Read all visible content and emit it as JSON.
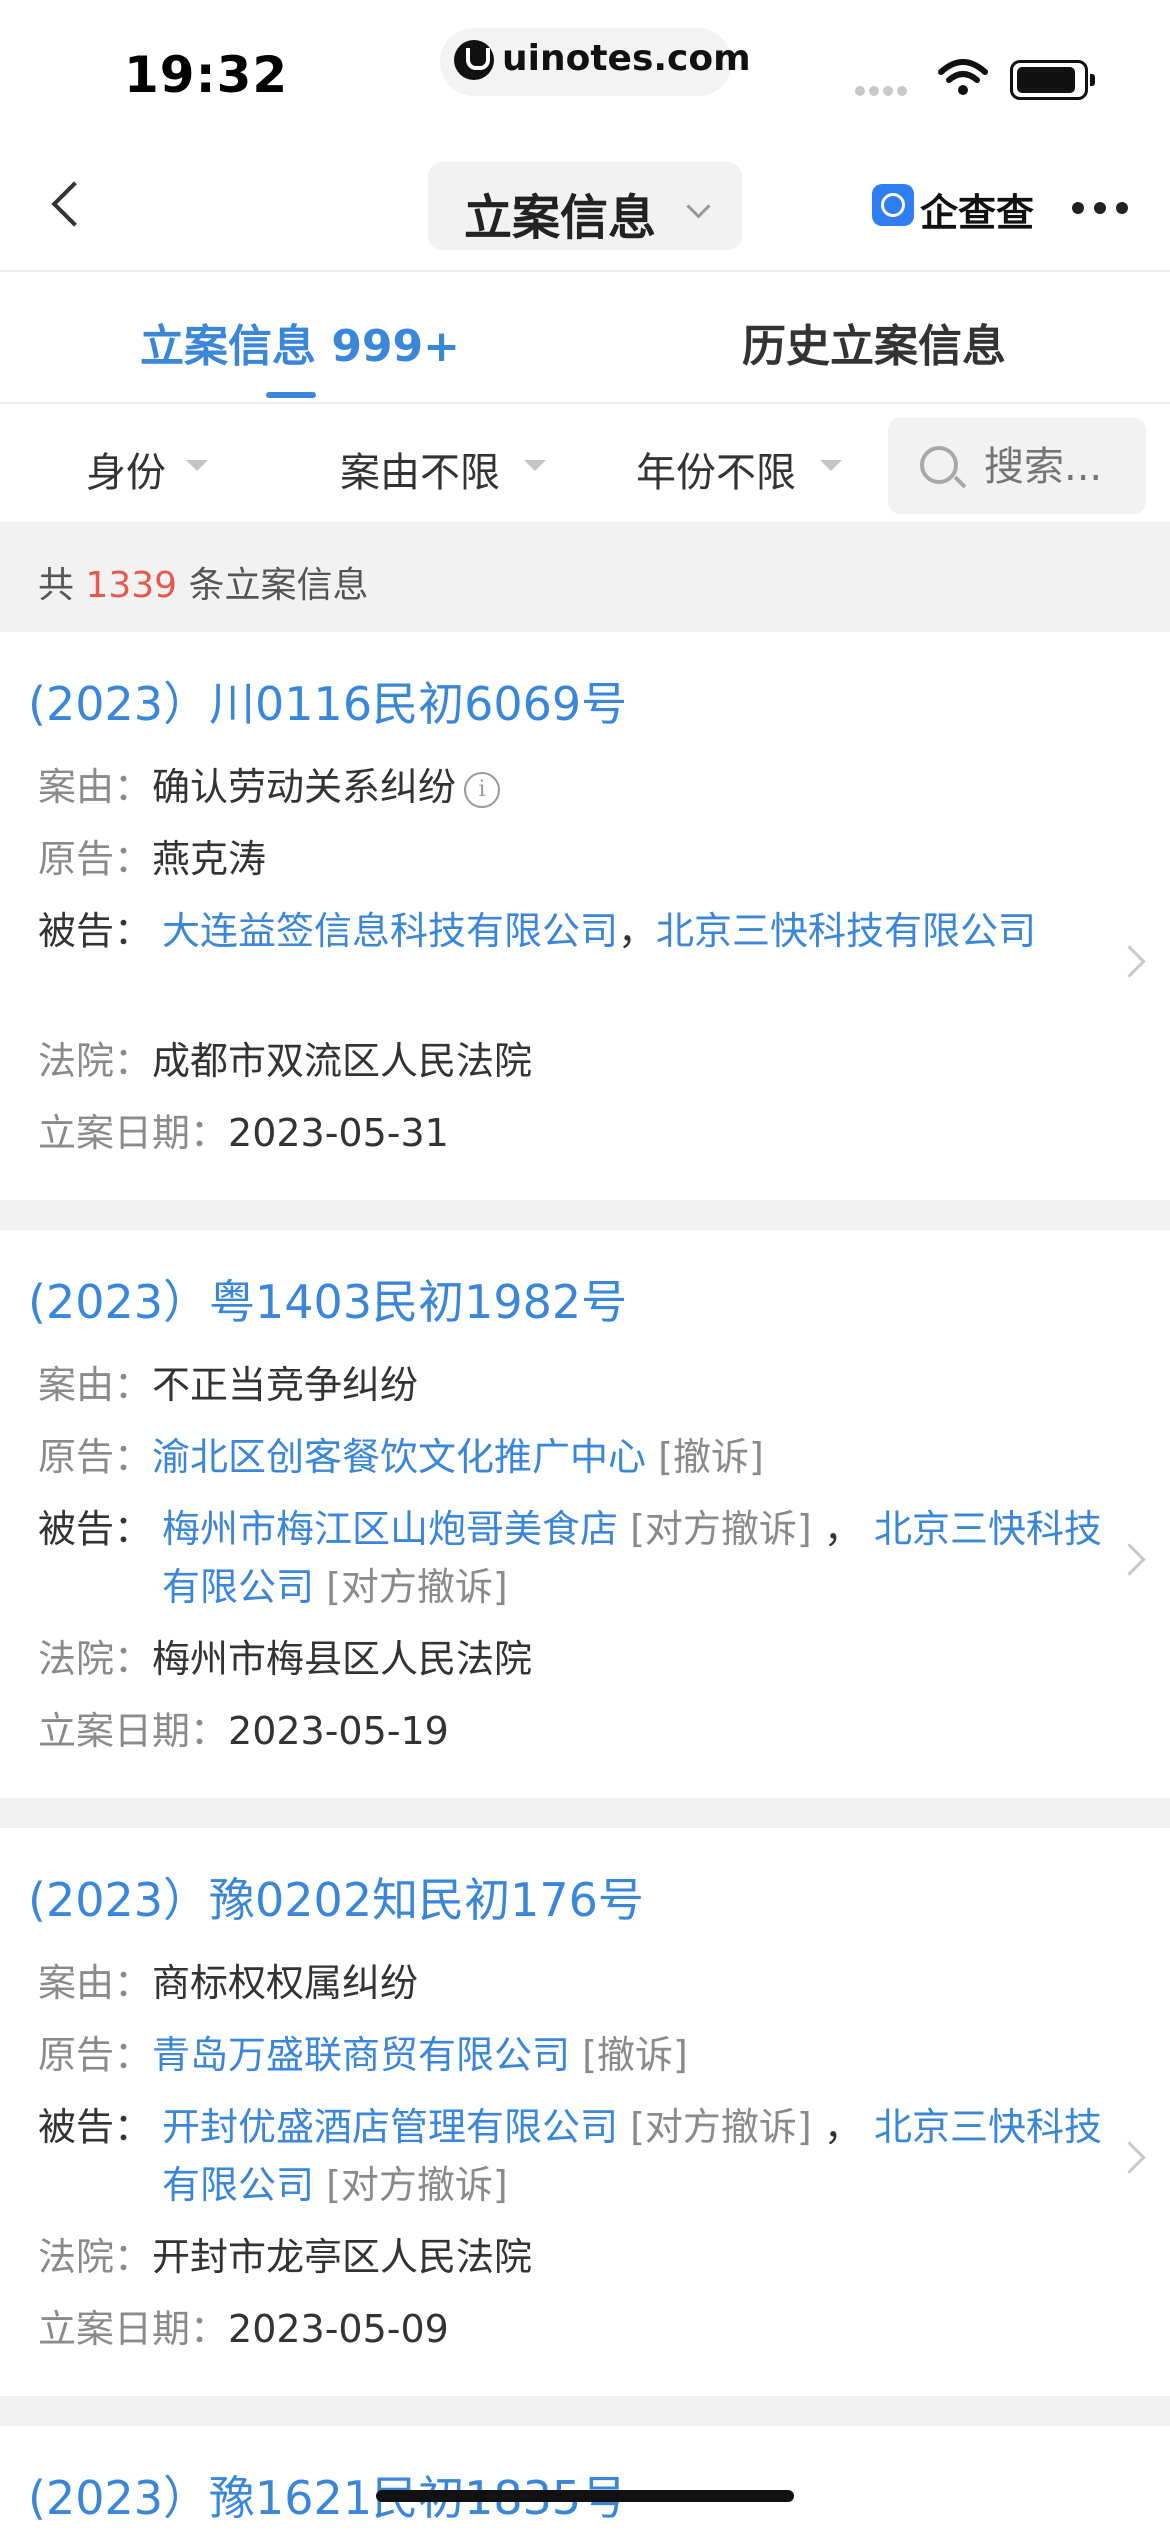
{
  "status_bar": {
    "time": "19:32",
    "url": "uinotes.com"
  },
  "navbar": {
    "title": "立案信息",
    "brand": "企查查"
  },
  "tabs": {
    "active": "立案信息 999+",
    "inactive": "历史立案信息"
  },
  "filters": {
    "identity": "身份",
    "cause": "案由不限",
    "year": "年份不限",
    "search_placeholder": "搜索..."
  },
  "summary": {
    "prefix": "共 ",
    "count": "1339",
    "suffix": " 条立案信息"
  },
  "labels": {
    "cause": "案由：",
    "plaintiff": "原告：",
    "defendant": "被告：",
    "court": "法院：",
    "date": "立案日期："
  },
  "cases": [
    {
      "case_no": "(2023）川0116民初6069号",
      "cause": "确认劳动关系纠纷",
      "plaintiff": "燕克涛",
      "defendant_1": "大连益签信息科技有限公司",
      "sep": "，",
      "defendant_2": "北京三快科技有限公司",
      "court": "成都市双流区人民法院",
      "date": "2023-05-31"
    },
    {
      "case_no": "(2023）粤1403民初1982号",
      "cause": "不正当竞争纠纷",
      "plaintiff": "渝北区创客餐饮文化推广中心",
      "plaintiff_tag": "[撤诉]",
      "defendant_1": "梅州市梅江区山炮哥美食店",
      "defendant_1_tag": "[对方撤诉]",
      "sep": " ，",
      "defendant_2": "北京三快科技有限公司",
      "defendant_2_tag": "[对方撤诉]",
      "court": "梅州市梅县区人民法院",
      "date": "2023-05-19"
    },
    {
      "case_no": "(2023）豫0202知民初176号",
      "cause": "商标权权属纠纷",
      "plaintiff": "青岛万盛联商贸有限公司",
      "plaintiff_tag": "[撤诉]",
      "defendant_1": "开封优盛酒店管理有限公司",
      "defendant_1_tag": "[对方撤诉]",
      "sep": " ，",
      "defendant_2": "北京三快科技有限公司",
      "defendant_2_tag": "[对方撤诉]",
      "court": "开封市龙亭区人民法院",
      "date": "2023-05-09"
    },
    {
      "case_no": "(2023）豫1621民初1835号"
    }
  ]
}
